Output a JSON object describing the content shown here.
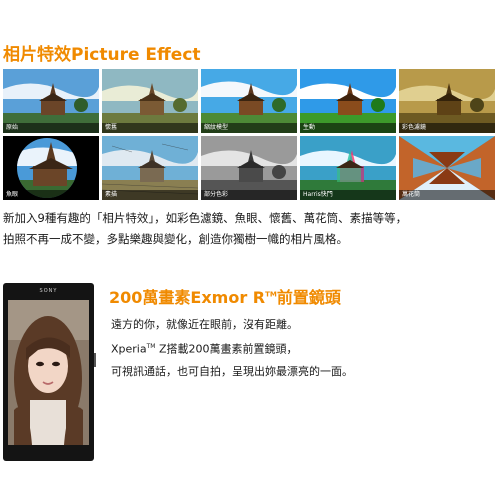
{
  "effects": {
    "title": "相片特效Picture Effect",
    "tiles": [
      {
        "label": "原始"
      },
      {
        "label": "懷舊"
      },
      {
        "label": "縮紋模型"
      },
      {
        "label": "生動"
      },
      {
        "label": "彩色濾鏡"
      },
      {
        "label": "魚眼"
      },
      {
        "label": "素描"
      },
      {
        "label": "部分色彩"
      },
      {
        "label": "Harris快門"
      },
      {
        "label": "萬花筒"
      }
    ],
    "description_line1": "新加入9種有趣的「相片特效」，如彩色濾鏡、魚眼、懷舊、萬花筒、素描等等，",
    "description_line2": "拍照不再一成不變，多點樂趣與變化，創造你獨樹一幟的相片風格。"
  },
  "front_camera": {
    "phone_brand": "SONY",
    "title_prefix": "200萬畫素Exmor R",
    "title_tm": "TM",
    "title_suffix": "前置鏡頭",
    "line1": "遠方的你，就像近在眼前，沒有距離。",
    "line2_prefix": "Xperia",
    "line2_tm": "TM",
    "line2_suffix": " Z搭載200萬畫素前置鏡頭，",
    "line3": "可視訊通話，也可自拍，呈現出妳最漂亮的一面。"
  }
}
